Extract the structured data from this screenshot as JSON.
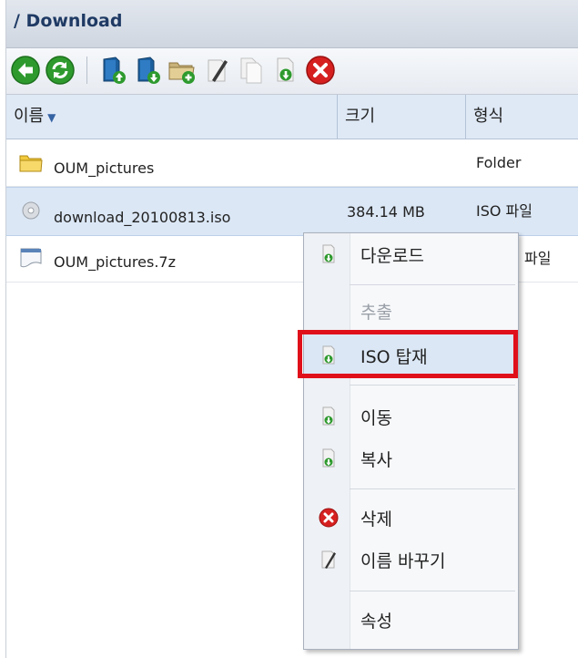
{
  "titlebar": {
    "title": "/ Download"
  },
  "toolbar": {
    "buttons": [
      {
        "name": "back-button",
        "icon": "back-arrow-icon"
      },
      {
        "name": "refresh-button",
        "icon": "refresh-icon"
      },
      {
        "name": "upload-button",
        "icon": "upload-icon"
      },
      {
        "name": "download-button",
        "icon": "download-icon"
      },
      {
        "name": "new-folder-button",
        "icon": "new-folder-icon"
      },
      {
        "name": "rename-button",
        "icon": "rename-icon"
      },
      {
        "name": "copy-button",
        "icon": "copy-icon"
      },
      {
        "name": "extract-button",
        "icon": "file-download-icon"
      },
      {
        "name": "delete-button",
        "icon": "delete-icon"
      }
    ]
  },
  "columns": {
    "name": "이름",
    "size": "크기",
    "type": "형식"
  },
  "files": [
    {
      "name": "OUM_pictures",
      "size": "",
      "type": "Folder",
      "icon": "folder-icon"
    },
    {
      "name": "download_20100813.iso",
      "size": "384.14 MB",
      "type": "ISO 파일",
      "icon": "disc-icon"
    },
    {
      "name": "OUM_pictures.7z",
      "size": "",
      "type": "파일",
      "icon": "archive-file-icon"
    }
  ],
  "context_menu": {
    "download": "다운로드",
    "extract": "추출",
    "mount_iso": "ISO 탑재",
    "move": "이동",
    "copy": "복사",
    "delete": "삭제",
    "rename": "이름 바꾸기",
    "properties": "속성"
  },
  "colors": {
    "highlight": "#e0101a",
    "selected_row": "#dbe7f5",
    "header_bg": "#dfe9f6"
  }
}
